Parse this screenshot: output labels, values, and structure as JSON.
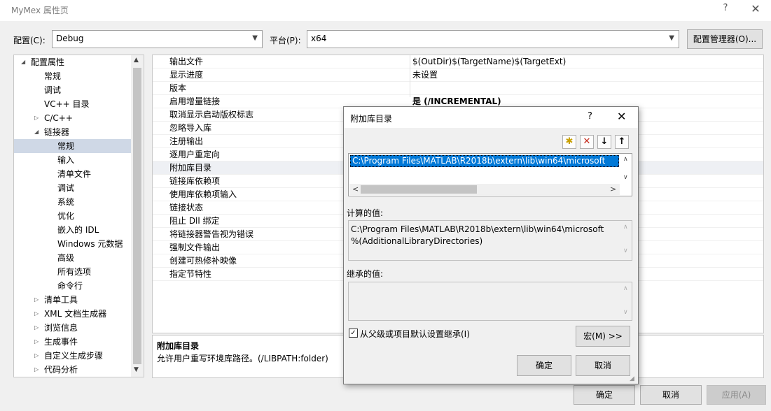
{
  "window": {
    "title": "MyMex 属性页",
    "help": "?",
    "close": "✕"
  },
  "config": {
    "config_label": "配置(C):",
    "config_value": "Debug",
    "platform_label": "平台(P):",
    "platform_value": "x64",
    "manager_button": "配置管理器(O)..."
  },
  "tree": {
    "items": [
      {
        "label": "配置属性",
        "toggle": "◢"
      },
      {
        "label": "常规"
      },
      {
        "label": "调试"
      },
      {
        "label": "VC++ 目录"
      },
      {
        "label": "C/C++",
        "toggle": "▷"
      },
      {
        "label": "链接器",
        "toggle": "◢"
      },
      {
        "label": "常规"
      },
      {
        "label": "输入"
      },
      {
        "label": "清单文件"
      },
      {
        "label": "调试"
      },
      {
        "label": "系统"
      },
      {
        "label": "优化"
      },
      {
        "label": "嵌入的 IDL"
      },
      {
        "label": "Windows 元数据"
      },
      {
        "label": "高级"
      },
      {
        "label": "所有选项"
      },
      {
        "label": "命令行"
      },
      {
        "label": "清单工具",
        "toggle": "▷"
      },
      {
        "label": "XML 文档生成器",
        "toggle": "▷"
      },
      {
        "label": "浏览信息",
        "toggle": "▷"
      },
      {
        "label": "生成事件",
        "toggle": "▷"
      },
      {
        "label": "自定义生成步骤",
        "toggle": "▷"
      },
      {
        "label": "代码分析",
        "toggle": "▷"
      }
    ],
    "scroll_up": "▲",
    "scroll_down": "▼"
  },
  "grid": {
    "rows": [
      {
        "name": "输出文件",
        "value": "$(OutDir)$(TargetName)$(TargetExt)"
      },
      {
        "name": "显示进度",
        "value": "未设置"
      },
      {
        "name": "版本",
        "value": ""
      },
      {
        "name": "启用增量链接",
        "value": "是 (/INCREMENTAL)"
      },
      {
        "name": "取消显示启动版权标志",
        "value": ""
      },
      {
        "name": "忽略导入库",
        "value": ""
      },
      {
        "name": "注册输出",
        "value": ""
      },
      {
        "name": "逐用户重定向",
        "value": ""
      },
      {
        "name": "附加库目录",
        "value": ""
      },
      {
        "name": "链接库依赖项",
        "value": ""
      },
      {
        "name": "使用库依赖项输入",
        "value": ""
      },
      {
        "name": "链接状态",
        "value": ""
      },
      {
        "name": "阻止 Dll 绑定",
        "value": ""
      },
      {
        "name": "将链接器警告视为错误",
        "value": ""
      },
      {
        "name": "强制文件输出",
        "value": ""
      },
      {
        "name": "创建可热修补映像",
        "value": ""
      },
      {
        "name": "指定节特性",
        "value": ""
      }
    ]
  },
  "description": {
    "title": "附加库目录",
    "text": "允许用户重写环境库路径。(/LIBPATH:folder)"
  },
  "dialog": {
    "title": "附加库目录",
    "help": "?",
    "close": "✕",
    "toolbar": {
      "new_folder": "✱",
      "delete": "✕",
      "move_down": "↓",
      "move_up": "↑"
    },
    "entries": [
      "C:\\Program Files\\MATLAB\\R2018b\\extern\\lib\\win64\\microsoft"
    ],
    "computed_label": "计算的值:",
    "computed_lines": [
      "C:\\Program Files\\MATLAB\\R2018b\\extern\\lib\\win64\\microsoft",
      "%(AdditionalLibraryDirectories)"
    ],
    "inherited_label": "继承的值:",
    "inherit_checkbox_label": "从父级或项目默认设置继承(I)",
    "inherit_checked": true,
    "macro_button": "宏(M) >>",
    "ok_button": "确定",
    "cancel_button": "取消"
  },
  "footer": {
    "ok_button": "确定",
    "cancel_button": "取消",
    "apply_button": "应用(A)"
  },
  "colors": {
    "selection": "#0078d7",
    "tree_selection": "#cfd8e6",
    "delete_icon": "#c42b1c"
  }
}
